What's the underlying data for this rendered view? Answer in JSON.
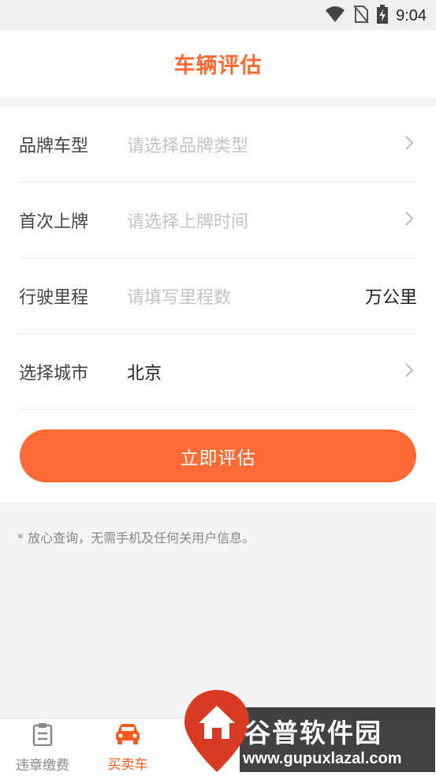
{
  "status_bar": {
    "time": "9:04",
    "icons": [
      "wifi-icon",
      "no-sim-icon",
      "battery-charging-icon"
    ]
  },
  "header": {
    "title": "车辆评估"
  },
  "form": {
    "rows": [
      {
        "label": "品牌车型",
        "value": "请选择品牌类型",
        "is_placeholder": true,
        "icon": "chevron-right-icon"
      },
      {
        "label": "首次上牌",
        "value": "请选择上牌时间",
        "is_placeholder": true,
        "icon": "chevron-right-icon"
      },
      {
        "label": "行驶里程",
        "value": "请填写里程数",
        "is_placeholder": true,
        "unit": "万公里"
      },
      {
        "label": "选择城市",
        "value": "北京",
        "is_placeholder": false,
        "icon": "chevron-right-icon"
      }
    ],
    "submit_label": "立即评估"
  },
  "note": "* 放心查询，无需手机及任何关用户信息。",
  "bottom_nav": {
    "tabs": [
      {
        "label": "违章缴费",
        "icon": "clipboard-icon",
        "active": false
      },
      {
        "label": "买卖车",
        "icon": "car-icon",
        "active": true
      }
    ]
  },
  "watermark": {
    "title": "谷普软件园",
    "url": "www.gupuxlazal.com",
    "icon": "home-pin-icon"
  },
  "colors": {
    "accent": "#ff6a35",
    "placeholder": "#c4c4c4"
  }
}
